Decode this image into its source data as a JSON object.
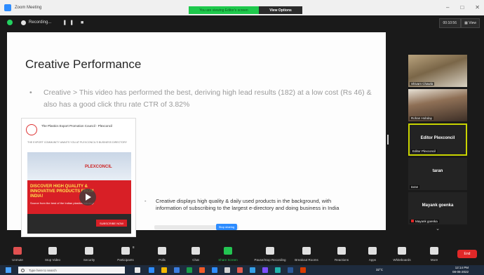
{
  "window": {
    "title": "Zoom Meeting"
  },
  "share_banner": {
    "status": "You are viewing Editor's screen",
    "view_options": "View Options"
  },
  "recording": {
    "label": "Recording..."
  },
  "meeting": {
    "timer": "00:10:56",
    "view": "View"
  },
  "slide": {
    "title": "Creative Performance",
    "bullet_marker": "•",
    "bullet": "Creative > This video has performed the best, deriving high lead results (182) at a low cost (Rs 46) & also has a good click thru rate CTR of 3.82%",
    "post": {
      "page_name": "The Plastics Export Promotion Council - Plexconcil",
      "body": "THE EXPORT COMMUNITY AWAITS YOU AT PLEXCONCIL'S BUSINESS DIRECTORY",
      "logo_text": "PLEXCONCIL",
      "headline": "DISCOVER HIGH QUALITY & INNOVATIVE PRODUCTS FROM INDIA!",
      "subtext": "Source from the best of the Indian plastics industry!",
      "cta": "SUBSCRIBE NOW"
    },
    "bullet2_marker": "-",
    "bullet2": "Creative displays high quality & daily used products in the background, with information of subscribing to the largest e-directory and doing business in India",
    "hover_chip": "Stop sharing"
  },
  "participants": [
    {
      "name": "Shivam Chawla"
    },
    {
      "name": "Rohan Hobday"
    },
    {
      "name": "Editor Plexconcil",
      "label": "Editor Plexconcil"
    },
    {
      "name": "taran",
      "label": "taran"
    },
    {
      "name": "Mayank goenka",
      "label": "Mayank goenka"
    }
  ],
  "toolbar": [
    {
      "label": "Unmute"
    },
    {
      "label": "Stop Video"
    },
    {
      "label": "Security"
    },
    {
      "label": "Participants"
    },
    {
      "label": "Polls"
    },
    {
      "label": "Chat"
    },
    {
      "label": "Share Screen"
    },
    {
      "label": "Pause/Stop Recording"
    },
    {
      "label": "Breakout Rooms"
    },
    {
      "label": "Reactions"
    },
    {
      "label": "Apps"
    },
    {
      "label": "Whiteboards"
    },
    {
      "label": "More"
    }
  ],
  "toolbar_extra": {
    "participants_count": "8",
    "end": "End"
  },
  "taskbar": {
    "search_placeholder": "Type here to search",
    "temperature": "32°C",
    "time": "12:14 PM",
    "date": "08-06-2022"
  },
  "colors": {
    "share_green": "#23c552",
    "end_red": "#e02828",
    "zoom_blue": "#2d8cff",
    "active_border": "#c9d400"
  }
}
